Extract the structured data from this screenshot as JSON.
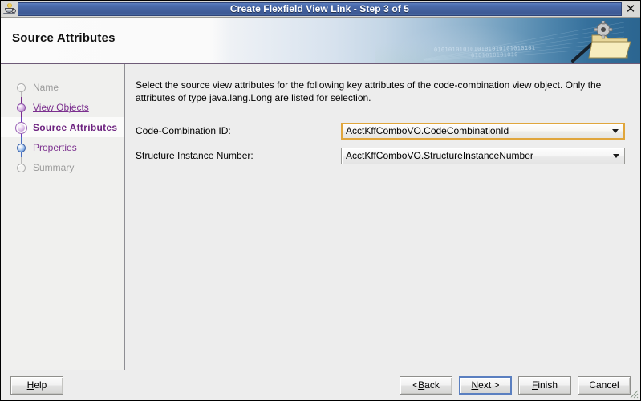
{
  "window": {
    "title": "Create Flexfield View Link - Step 3 of 5",
    "icon": "java-coffee-cup-icon",
    "close_label": "✕"
  },
  "banner": {
    "heading": "Source Attributes",
    "binary_line_1": "0101010101010101010101010101",
    "binary_line_2": "0101010101010",
    "art": "folder-gear-wand-icon"
  },
  "sidebar": {
    "steps": [
      {
        "label": "Name",
        "state": "disabled"
      },
      {
        "label": "View Objects",
        "state": "link"
      },
      {
        "label": "Source Attributes",
        "state": "current"
      },
      {
        "label": "Properties",
        "state": "link"
      },
      {
        "label": "Summary",
        "state": "disabled"
      }
    ]
  },
  "content": {
    "intro": "Select the source view attributes for the following key attributes of the code-combination view object. Only the attributes of type java.lang.Long are listed for selection.",
    "fields": [
      {
        "label": "Code-Combination ID:",
        "value": "AcctKffComboVO.CodeCombinationId",
        "focused": true
      },
      {
        "label": "Structure Instance Number:",
        "value": "AcctKffComboVO.StructureInstanceNumber",
        "focused": false
      }
    ]
  },
  "footer": {
    "help": {
      "pre": "",
      "mnemonic": "H",
      "post": "elp"
    },
    "back": {
      "pre": "< ",
      "mnemonic": "B",
      "post": "ack"
    },
    "next": {
      "pre": "",
      "mnemonic": "N",
      "post": "ext >"
    },
    "finish": {
      "pre": "",
      "mnemonic": "F",
      "post": "inish"
    },
    "cancel": {
      "pre": "Cancel",
      "mnemonic": "",
      "post": ""
    }
  },
  "colors": {
    "titlebar_blue": "#44629f",
    "focus_orange": "#e0a63c",
    "focus_blue": "#5a7fc0",
    "step_purple": "#7b2f8e",
    "banner_teal": "#2b6590"
  }
}
